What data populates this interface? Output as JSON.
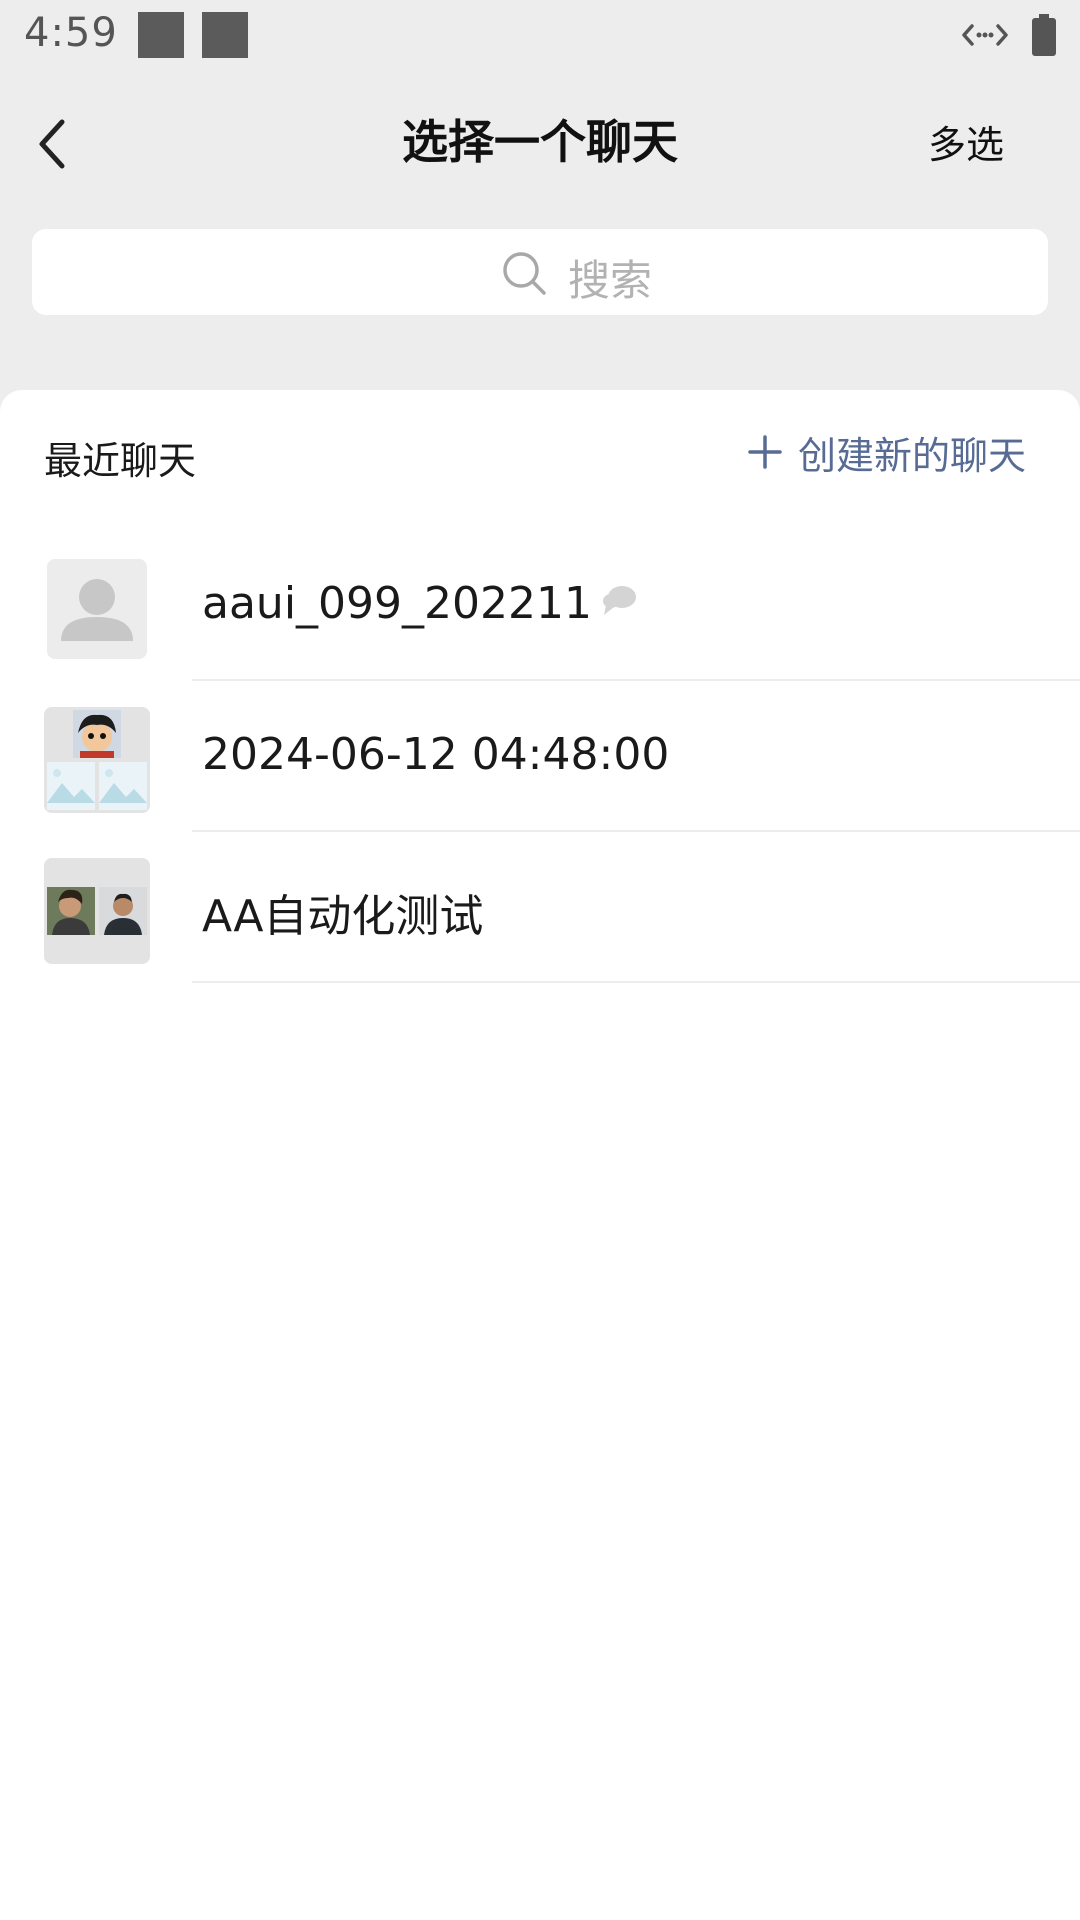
{
  "status_bar": {
    "time": "4:59"
  },
  "header": {
    "title": "选择一个聊天",
    "multi_select_label": "多选"
  },
  "search": {
    "placeholder": "搜索"
  },
  "recent": {
    "section_title": "最近聊天",
    "new_chat_label": "创建新的聊天"
  },
  "chats": [
    {
      "name": "aaui_099_202211",
      "avatar": "default-person",
      "muted": true
    },
    {
      "name": "2024-06-12 04:48:00",
      "avatar": "group-grid",
      "muted": false
    },
    {
      "name": "AA自动化测试",
      "avatar": "group-two-photos",
      "muted": false
    }
  ],
  "colors": {
    "background": "#ededed",
    "accent_link": "#576b95",
    "placeholder": "#b2b2b2"
  }
}
